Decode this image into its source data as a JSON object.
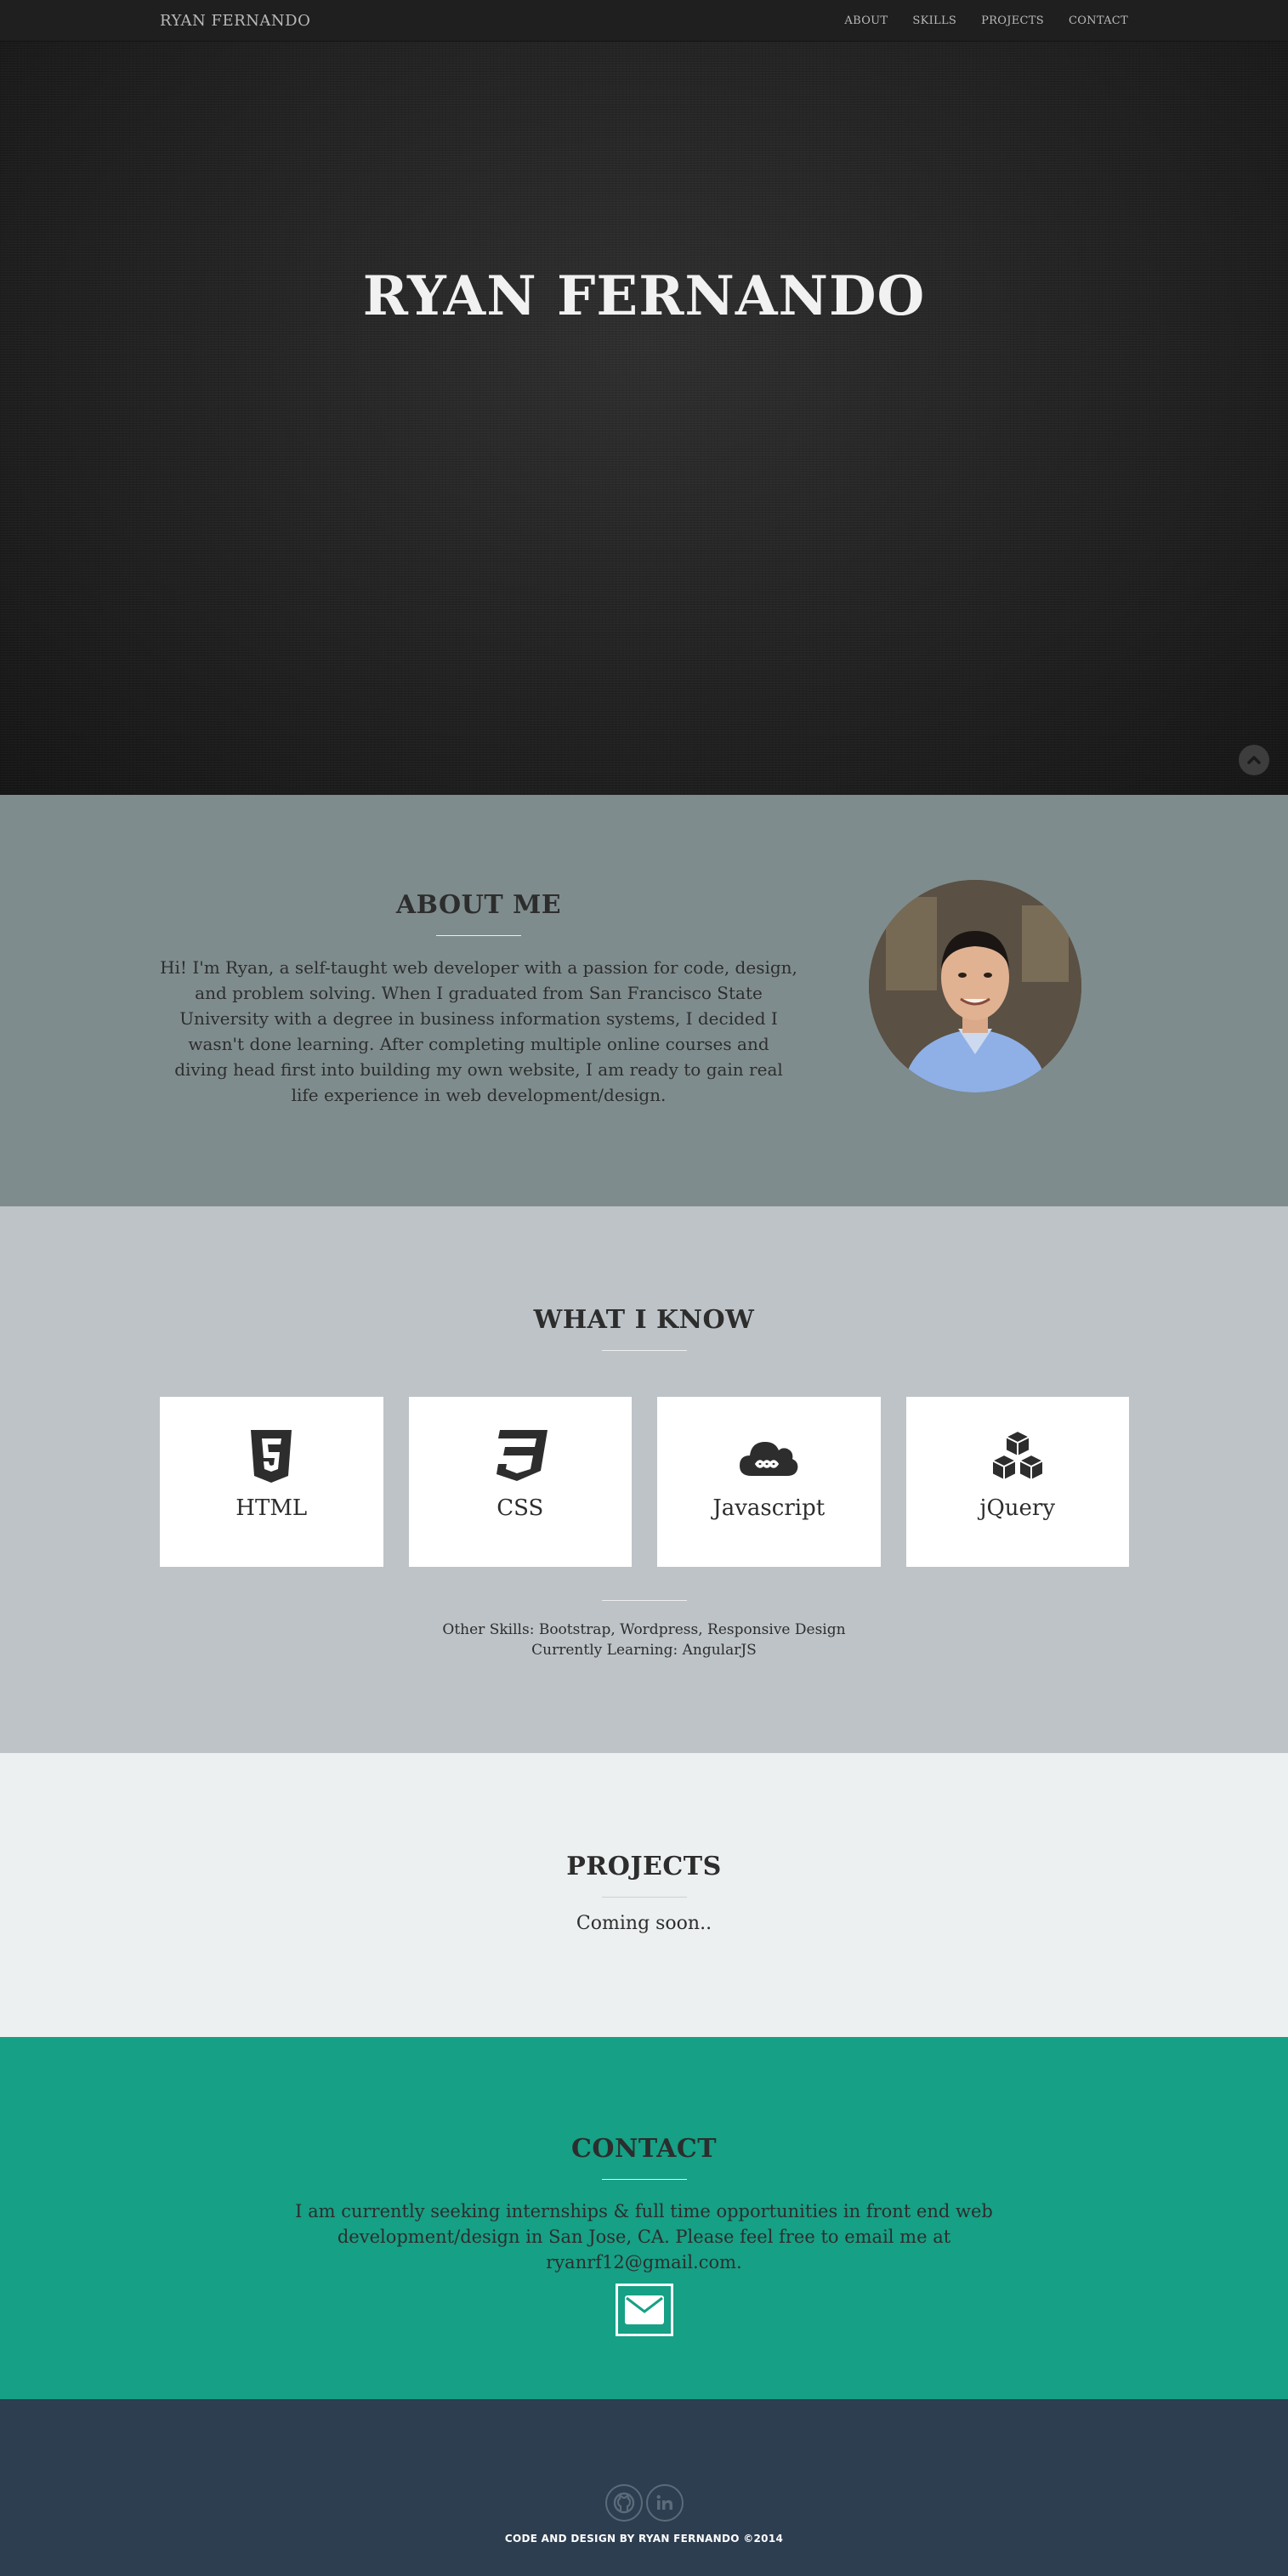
{
  "navbar": {
    "brand": "RYAN FERNANDO",
    "links": [
      "ABOUT",
      "SKILLS",
      "PROJECTS",
      "CONTACT"
    ]
  },
  "hero": {
    "title": "RYAN FERNANDO",
    "scroll_icon": "chevron-up-icon"
  },
  "about": {
    "heading": "ABOUT ME",
    "body": "Hi! I'm Ryan, a self-taught web developer with a passion for code, design, and problem solving. When I graduated from San Francisco State University with a degree in business information systems, I decided I wasn't done learning. After completing multiple online courses and diving head first into building my own website, I am ready to gain real life experience in web development/design.",
    "photo_icon": "profile-photo"
  },
  "skills": {
    "heading": "WHAT I KNOW",
    "cards": [
      {
        "label": "HTML",
        "icon": "html5-icon"
      },
      {
        "label": "CSS",
        "icon": "css3-icon"
      },
      {
        "label": "Javascript",
        "icon": "cloud-infinity-icon"
      },
      {
        "label": "jQuery",
        "icon": "cubes-icon"
      }
    ],
    "other": "Other Skills: Bootstrap, Wordpress, Responsive Design",
    "learning": "Currently Learning: AngularJS"
  },
  "projects": {
    "heading": "PROJECTS",
    "text": "Coming soon.."
  },
  "contact": {
    "heading": "CONTACT",
    "text": "I am currently seeking internships & full time opportunities in front end web development/design in San Jose, CA. Please feel free to email me at ryanrf12@gmail.com.",
    "email_icon": "envelope-icon"
  },
  "footer": {
    "social_icons": [
      "github-icon",
      "linkedin-icon"
    ],
    "copyright": "CODE AND DESIGN BY RYAN FERNANDO ©2014"
  },
  "colors": {
    "nav": "#1f1f1f",
    "about_bg": "#7f8c8d",
    "skills_bg": "#bdc3c7",
    "projects_bg": "#ecf0f1",
    "contact_bg": "#16a085",
    "footer_bg": "#2c3e50"
  }
}
